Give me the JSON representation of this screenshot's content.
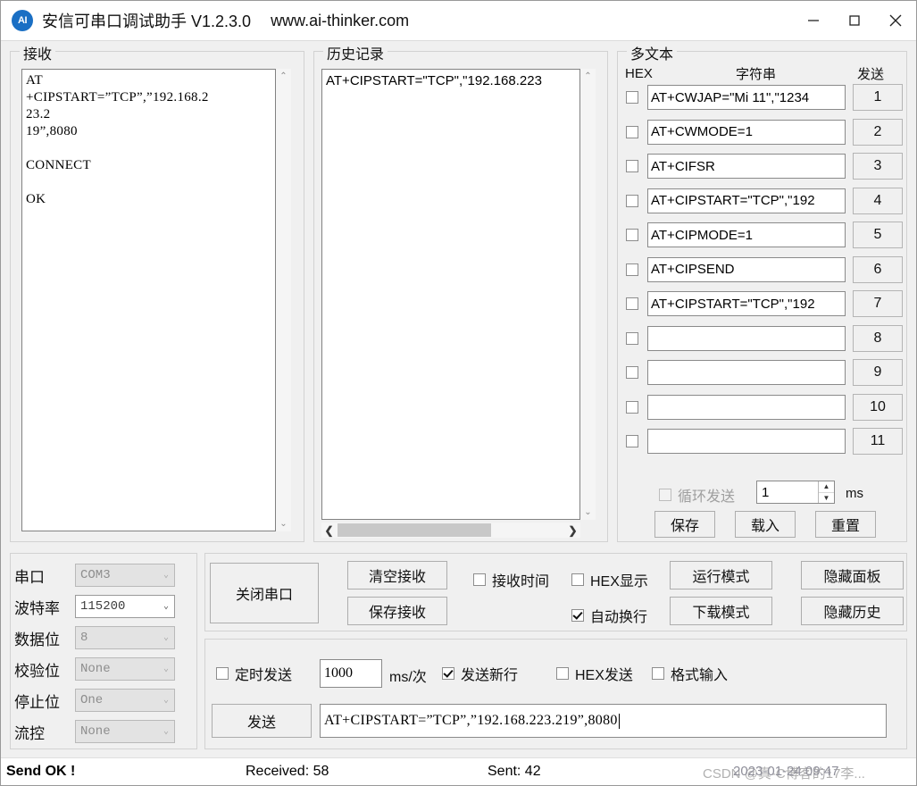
{
  "window": {
    "title": "安信可串口调试助手 V1.2.3.0",
    "url": "www.ai-thinker.com",
    "logo_text": "AI",
    "minimize_label": "minimize",
    "maximize_label": "maximize",
    "close_label": "close"
  },
  "receive_panel": {
    "legend": "接收",
    "content": "AT\n+CIPSTART=”TCP”,”192.168.2\n23.2\n19”,8080\n\nCONNECT\n\nOK"
  },
  "history_panel": {
    "legend": "历史记录",
    "content": "AT+CIPSTART=\"TCP\",\"192.168.223"
  },
  "multitext_panel": {
    "legend": "多文本",
    "col_hex": "HEX",
    "col_string": "字符串",
    "col_send": "发送",
    "rows": [
      {
        "hex": false,
        "text": "AT+CWJAP=\"Mi 11\",\"1234",
        "btn": "1"
      },
      {
        "hex": false,
        "text": "AT+CWMODE=1",
        "btn": "2"
      },
      {
        "hex": false,
        "text": "AT+CIFSR",
        "btn": "3"
      },
      {
        "hex": false,
        "text": "AT+CIPSTART=\"TCP\",\"192",
        "btn": "4"
      },
      {
        "hex": false,
        "text": "AT+CIPMODE=1",
        "btn": "5"
      },
      {
        "hex": false,
        "text": "AT+CIPSEND",
        "btn": "6"
      },
      {
        "hex": false,
        "text": "AT+CIPSTART=\"TCP\",\"192",
        "btn": "7"
      },
      {
        "hex": false,
        "text": "",
        "btn": "8"
      },
      {
        "hex": false,
        "text": "",
        "btn": "9"
      },
      {
        "hex": false,
        "text": "",
        "btn": "10"
      },
      {
        "hex": false,
        "text": "",
        "btn": "11"
      }
    ],
    "loop_send_label": "循环发送",
    "loop_send_checked": false,
    "loop_send_enabled": false,
    "loop_interval": "1",
    "loop_unit": "ms",
    "save_btn": "保存",
    "load_btn": "载入",
    "reset_btn": "重置"
  },
  "serial_config": {
    "rows": [
      {
        "label": "串口",
        "value": "COM3",
        "enabled": false
      },
      {
        "label": "波特率",
        "value": "115200",
        "enabled": true
      },
      {
        "label": "数据位",
        "value": "8",
        "enabled": false
      },
      {
        "label": "校验位",
        "value": "None",
        "enabled": false
      },
      {
        "label": "停止位",
        "value": "One",
        "enabled": false
      },
      {
        "label": "流控",
        "value": "None",
        "enabled": false
      }
    ]
  },
  "controls": {
    "toggle_port_btn": "关闭串口",
    "clear_recv_btn": "清空接收",
    "save_recv_btn": "保存接收",
    "recv_time_label": "接收时间",
    "recv_time_checked": false,
    "hex_display_label": "HEX显示",
    "hex_display_checked": false,
    "auto_wrap_label": "自动换行",
    "auto_wrap_checked": true,
    "run_mode_btn": "运行模式",
    "download_mode_btn": "下载模式",
    "hide_panel_btn": "隐藏面板",
    "hide_history_btn": "隐藏历史"
  },
  "send_area": {
    "timed_send_label": "定时发送",
    "timed_send_checked": false,
    "timed_interval": "1000",
    "interval_unit": "ms/次",
    "send_newline_label": "发送新行",
    "send_newline_checked": true,
    "hex_send_label": "HEX发送",
    "hex_send_checked": false,
    "format_input_label": "格式输入",
    "format_input_checked": false,
    "send_btn": "发送",
    "send_value": "AT+CIPSTART=”TCP”,”192.168.223.219”,8080"
  },
  "statusbar": {
    "status": "Send OK !",
    "received": "Received: 58",
    "sent": "Sent: 42",
    "watermark_1": "CSDN @真-C博客的17李...",
    "watermark_2": "2023-01-24 09:47"
  },
  "icons": {
    "chevron_up": "⌃",
    "chevron_down": "⌄",
    "arrow_left": "❮",
    "arrow_right": "❯",
    "spin_up": "▲",
    "spin_down": "▼",
    "combo_chevron": "⌄"
  }
}
